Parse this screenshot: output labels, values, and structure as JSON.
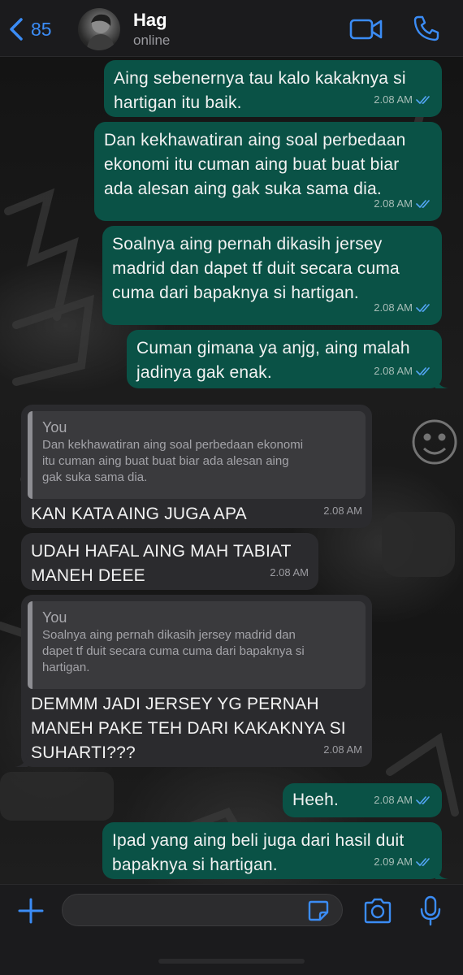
{
  "header": {
    "back_count": "85",
    "contact_name": "Hag",
    "contact_status": "online"
  },
  "messages": [
    {
      "direction": "out",
      "text": "Aing sebenernya tau kalo kakaknya si\nhartigan itu baik.",
      "time": "2.08 AM",
      "read": true
    },
    {
      "direction": "out",
      "text": "Dan kekhawatiran aing soal perbedaan\nekonomi itu cuman aing buat buat biar\nada alesan aing gak suka sama dia.",
      "time": "2.08 AM",
      "read": true
    },
    {
      "direction": "out",
      "text": "Soalnya aing pernah dikasih jersey\nmadrid dan dapet tf duit secara cuma\ncuma dari bapaknya si hartigan.",
      "time": "2.08 AM",
      "read": true
    },
    {
      "direction": "out",
      "text": "Cuman gimana ya anjg, aing malah\njadinya gak enak.",
      "time": "2.08 AM",
      "read": true
    },
    {
      "direction": "in",
      "quote": {
        "author": "You",
        "text": "Dan kekhawatiran aing soal perbedaan ekonomi\nitu cuman aing buat buat biar ada alesan aing\ngak suka sama dia."
      },
      "text": "KAN KATA AING JUGA APA",
      "time": "2.08 AM"
    },
    {
      "direction": "in",
      "text": "UDAH HAFAL AING MAH TABIAT\nMANEH DEEE",
      "time": "2.08 AM"
    },
    {
      "direction": "in",
      "quote": {
        "author": "You",
        "text": "Soalnya aing pernah dikasih jersey madrid dan\ndapet tf duit secara cuma cuma dari bapaknya si\nhartigan."
      },
      "text": "DEMMM JADI JERSEY YG PERNAH\nMANEH PAKE TEH DARI KAKAKNYA SI\nSUHARTI???",
      "time": "2.08 AM"
    },
    {
      "direction": "out",
      "text": "Heeh.",
      "time": "2.08 AM",
      "read": true
    },
    {
      "direction": "out",
      "text": "Ipad yang aing beli juga dari hasil duit\nbapaknya si hartigan.",
      "time": "2.09 AM",
      "read": true
    }
  ],
  "input": {
    "placeholder": ""
  },
  "colors": {
    "accent": "#3b8cf5",
    "outgoing_bubble": "#0a5246",
    "incoming_bubble": "#2b2b2e",
    "read_ticks": "#53a6f5"
  },
  "icons": [
    "chevron-left-icon",
    "video-icon",
    "phone-icon",
    "plus-icon",
    "sticker-icon",
    "camera-icon",
    "microphone-icon",
    "double-check-icon"
  ]
}
